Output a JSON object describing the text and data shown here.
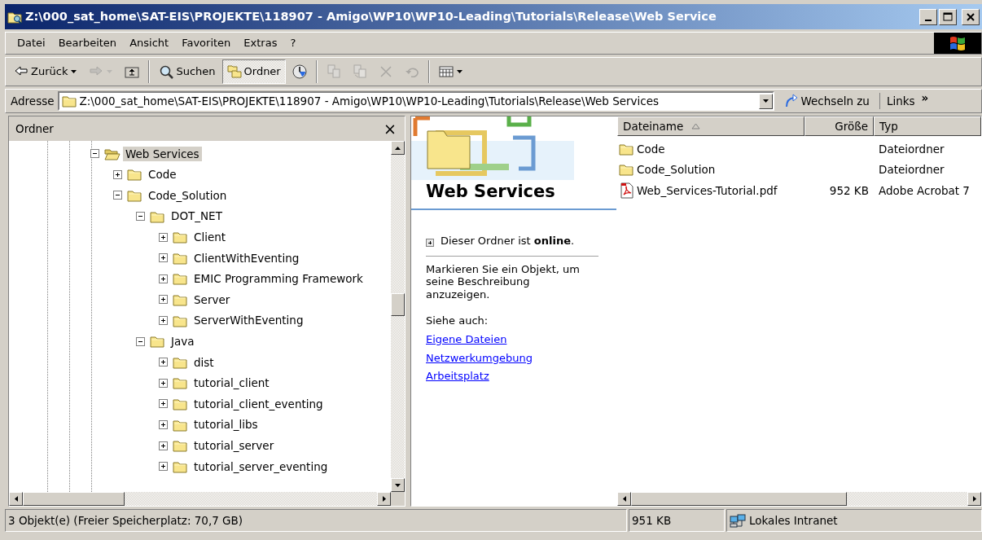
{
  "window": {
    "title": "Z:\\000_sat_home\\SAT-EIS\\PROJEKTE\\118907 - Amigo\\WP10\\WP10-Leading\\Tutorials\\Release\\Web Service"
  },
  "menu": [
    {
      "label": "Datei"
    },
    {
      "label": "Bearbeiten"
    },
    {
      "label": "Ansicht"
    },
    {
      "label": "Favoriten"
    },
    {
      "label": "Extras"
    },
    {
      "label": "?"
    }
  ],
  "toolbar": [
    {
      "kind": "back",
      "label": "Zurück",
      "disabled": false,
      "pressed": false
    },
    {
      "kind": "forward",
      "disabled": true,
      "pressed": false
    },
    {
      "kind": "up",
      "disabled": false,
      "pressed": false
    },
    {
      "kind": "search",
      "label": "Suchen",
      "disabled": false,
      "pressed": false
    },
    {
      "kind": "folders",
      "label": "Ordner",
      "disabled": false,
      "pressed": true
    },
    {
      "kind": "history",
      "disabled": false,
      "pressed": false
    },
    {
      "kind": "move",
      "disabled": true,
      "pressed": false
    },
    {
      "kind": "copy",
      "disabled": true,
      "pressed": false
    },
    {
      "kind": "delete",
      "disabled": true,
      "pressed": false
    },
    {
      "kind": "undo",
      "disabled": true,
      "pressed": false
    },
    {
      "kind": "views",
      "disabled": false,
      "pressed": false
    }
  ],
  "address": {
    "label": "Adresse",
    "value": "Z:\\000_sat_home\\SAT-EIS\\PROJEKTE\\118907 - Amigo\\WP10\\WP10-Leading\\Tutorials\\Release\\Web Services",
    "go": "Wechseln zu",
    "links": "Links",
    "links_more": "»"
  },
  "folder_pane": {
    "title": "Ordner",
    "close": "×",
    "tree": [
      {
        "label": "Web Services",
        "expanded": true,
        "selected": true,
        "children": [
          {
            "label": "Code",
            "expanded": false,
            "selected": false
          },
          {
            "label": "Code_Solution",
            "expanded": true,
            "selected": false,
            "children": [
              {
                "label": "DOT_NET",
                "expanded": true,
                "selected": false,
                "children": [
                  {
                    "label": "Client",
                    "expanded": false,
                    "selected": false
                  },
                  {
                    "label": "ClientWithEventing",
                    "expanded": false,
                    "selected": false
                  },
                  {
                    "label": "EMIC Programming Framework",
                    "expanded": false,
                    "selected": false
                  },
                  {
                    "label": "Server",
                    "expanded": false,
                    "selected": false
                  },
                  {
                    "label": "ServerWithEventing",
                    "expanded": false,
                    "selected": false
                  }
                ]
              },
              {
                "label": "Java",
                "expanded": true,
                "selected": false,
                "children": [
                  {
                    "label": "dist",
                    "expanded": false,
                    "selected": false
                  },
                  {
                    "label": "tutorial_client",
                    "expanded": false,
                    "selected": false
                  },
                  {
                    "label": "tutorial_client_eventing",
                    "expanded": false,
                    "selected": false
                  },
                  {
                    "label": "tutorial_libs",
                    "expanded": false,
                    "selected": false
                  },
                  {
                    "label": "tutorial_server",
                    "expanded": false,
                    "selected": false
                  },
                  {
                    "label": "tutorial_server_eventing",
                    "expanded": false,
                    "selected": false
                  }
                ]
              }
            ]
          }
        ]
      }
    ]
  },
  "web_view": {
    "heading": "Web Services",
    "status": "Dieser Ordner ist **online**.",
    "hint": "Markieren Sie ein Objekt, um seine Beschreibung anzuzeigen.",
    "see_also": "Siehe auch:",
    "links": [
      {
        "label": "Eigene Dateien"
      },
      {
        "label": "Netzwerkumgebung"
      },
      {
        "label": "Arbeitsplatz"
      }
    ]
  },
  "file_list": {
    "columns": [
      {
        "label": "Dateiname",
        "sorted": true
      },
      {
        "label": "Größe",
        "sorted": false
      },
      {
        "label": "Typ",
        "sorted": false
      }
    ],
    "rows": [
      {
        "kind": "folder",
        "name": "Code",
        "type": "Dateiordner"
      },
      {
        "kind": "folder",
        "name": "Code_Solution",
        "type": "Dateiordner"
      },
      {
        "kind": "pdf",
        "name": "Web_Services-Tutorial.pdf",
        "size": "952 KB",
        "type": "Adobe Acrobat 7"
      }
    ]
  },
  "status_bar": {
    "objects": "3 Objekt(e)  (Freier Speicherplatz: 70,7 GB)",
    "size": "951 KB",
    "zone": "Lokales Intranet"
  }
}
